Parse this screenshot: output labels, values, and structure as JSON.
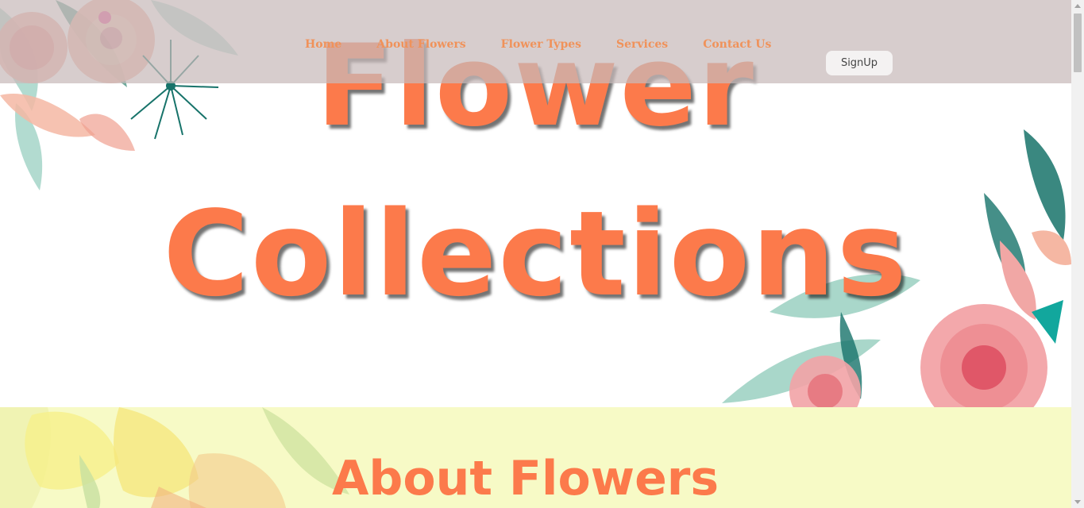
{
  "nav": {
    "links": [
      {
        "label": "Home"
      },
      {
        "label": "About Flowers"
      },
      {
        "label": "Flower Types"
      },
      {
        "label": "Services"
      },
      {
        "label": "Contact Us"
      }
    ],
    "signup_label": "SignUp"
  },
  "hero": {
    "line1": "Flower",
    "line2": "Collections"
  },
  "about": {
    "title": "About Flowers"
  },
  "colors": {
    "accent": "#fc7a4b",
    "nav_link": "#f0925a",
    "navbar_bg": "#c8baba",
    "about_bg": "#f7fac6"
  }
}
